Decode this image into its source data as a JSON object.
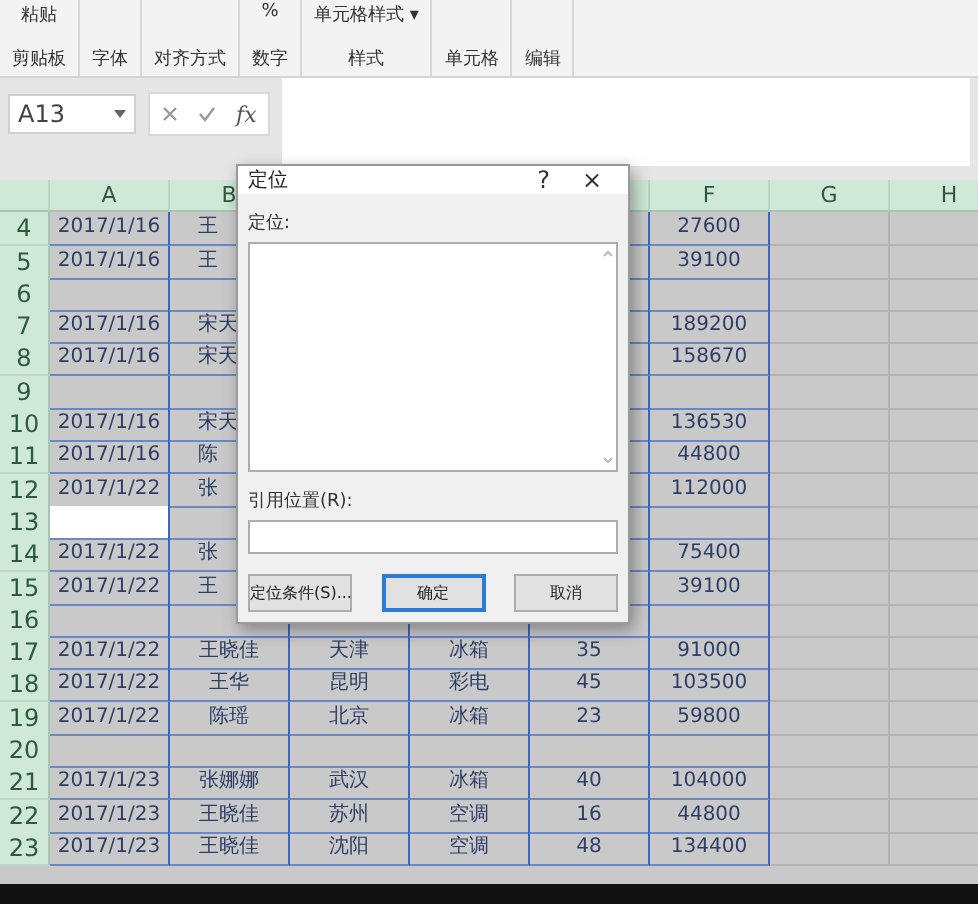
{
  "ribbon": {
    "groups": [
      {
        "label": "剪贴板",
        "tools": [
          "粘贴"
        ]
      },
      {
        "label": "字体"
      },
      {
        "label": "对齐方式"
      },
      {
        "label": "数字",
        "tools": [
          "%"
        ]
      },
      {
        "label": "样式",
        "tools": [
          "单元格样式 ▾"
        ]
      },
      {
        "label": "单元格"
      },
      {
        "label": "编辑"
      }
    ]
  },
  "formula_bar": {
    "name_box": "A13",
    "fx": "fx"
  },
  "columns": [
    {
      "label": "A"
    },
    {
      "label": "B"
    },
    {},
    {},
    {},
    {
      "label": "F"
    },
    {
      "label": "G"
    },
    {
      "label": "H"
    }
  ],
  "rows": [
    {
      "number": "4",
      "a": "2017/1/16",
      "b": "王",
      "f": "27600"
    },
    {
      "number": "5",
      "a": "2017/1/16",
      "b": "王",
      "f": "39100"
    },
    {
      "number": "6"
    },
    {
      "number": "7",
      "a": "2017/1/16",
      "b": "宋天",
      "f": "189200"
    },
    {
      "number": "8",
      "a": "2017/1/16",
      "b": "宋天",
      "f": "158670"
    },
    {
      "number": "9"
    },
    {
      "number": "10",
      "a": "2017/1/16",
      "b": "宋天",
      "f": "136530"
    },
    {
      "number": "11",
      "a": "2017/1/16",
      "b": "陈",
      "f": "44800"
    },
    {
      "number": "12",
      "a": "2017/1/22",
      "b": "张",
      "f": "112000"
    },
    {
      "number": "13",
      "active": true
    },
    {
      "number": "14",
      "a": "2017/1/22",
      "b": "张",
      "f": "75400"
    },
    {
      "number": "15",
      "a": "2017/1/22",
      "b": "王",
      "f": "39100"
    },
    {
      "number": "16"
    },
    {
      "number": "17",
      "a": "2017/1/22",
      "b": "王晓佳",
      "c": "天津",
      "d": "冰箱",
      "e": "35",
      "f": "91000"
    },
    {
      "number": "18",
      "a": "2017/1/22",
      "b": "王华",
      "c": "昆明",
      "d": "彩电",
      "e": "45",
      "f": "103500"
    },
    {
      "number": "19",
      "a": "2017/1/22",
      "b": "陈瑶",
      "c": "北京",
      "d": "冰箱",
      "e": "23",
      "f": "59800"
    },
    {
      "number": "20"
    },
    {
      "number": "21",
      "a": "2017/1/23",
      "b": "张娜娜",
      "c": "武汉",
      "d": "冰箱",
      "e": "40",
      "f": "104000"
    },
    {
      "number": "22",
      "a": "2017/1/23",
      "b": "王晓佳",
      "c": "苏州",
      "d": "空调",
      "e": "16",
      "f": "44800"
    },
    {
      "number": "23",
      "a": "2017/1/23",
      "b": "王晓佳",
      "c": "沈阳",
      "d": "空调",
      "e": "48",
      "f": "134400"
    }
  ],
  "dialog": {
    "title": "定位",
    "help": "?",
    "close": "×",
    "list_label": "定位:",
    "reference_label": "引用位置(R):",
    "buttons": [
      {
        "label": "定位条件(S)...",
        "kind": "plain"
      },
      {
        "label": "确定",
        "kind": "default"
      },
      {
        "label": "取消",
        "kind": "plain"
      }
    ]
  }
}
